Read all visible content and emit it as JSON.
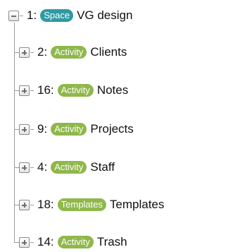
{
  "tree": {
    "root": {
      "id": "1:",
      "badge": "Space",
      "name": "VG design",
      "expanded": true,
      "toggle_icon": "minus-icon"
    },
    "children": [
      {
        "id": "2:",
        "badge": "Activity",
        "name": "Clients",
        "expanded": false,
        "toggle_icon": "plus-icon"
      },
      {
        "id": "16:",
        "badge": "Activity",
        "name": "Notes",
        "expanded": false,
        "toggle_icon": "plus-icon"
      },
      {
        "id": "9:",
        "badge": "Activity",
        "name": "Projects",
        "expanded": false,
        "toggle_icon": "plus-icon"
      },
      {
        "id": "4:",
        "badge": "Activity",
        "name": "Staff",
        "expanded": false,
        "toggle_icon": "plus-icon"
      },
      {
        "id": "18:",
        "badge": "Templates",
        "name": "Templates",
        "expanded": false,
        "toggle_icon": "plus-icon"
      },
      {
        "id": "14:",
        "badge": "Activity",
        "name": "Trash",
        "expanded": false,
        "toggle_icon": "plus-icon"
      }
    ]
  },
  "colors": {
    "space_badge": "#2f9aa3",
    "activity_badge": "#8fb74b",
    "tree_lines": "#9a9a9a"
  }
}
